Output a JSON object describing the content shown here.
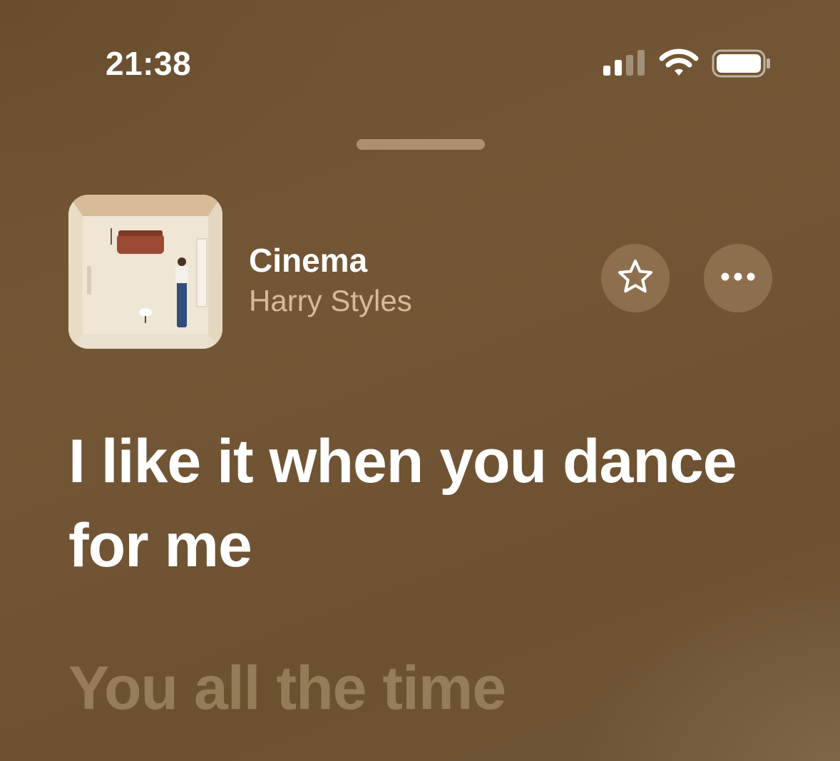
{
  "status_bar": {
    "time": "21:38",
    "signal_icon": "cellular-signal-icon",
    "wifi_icon": "wifi-icon",
    "battery_icon": "battery-icon"
  },
  "now_playing": {
    "title": "Cinema",
    "artist": "Harry Styles",
    "favorite_icon": "star-icon",
    "more_icon": "ellipsis-icon"
  },
  "lyrics": {
    "current": "I like it when you dance for me",
    "next": "You all the time"
  },
  "colors": {
    "background": "#6e5232",
    "text_primary": "#ffffff",
    "text_secondary": "#e6cdaa",
    "button_bg": "#af916e"
  }
}
